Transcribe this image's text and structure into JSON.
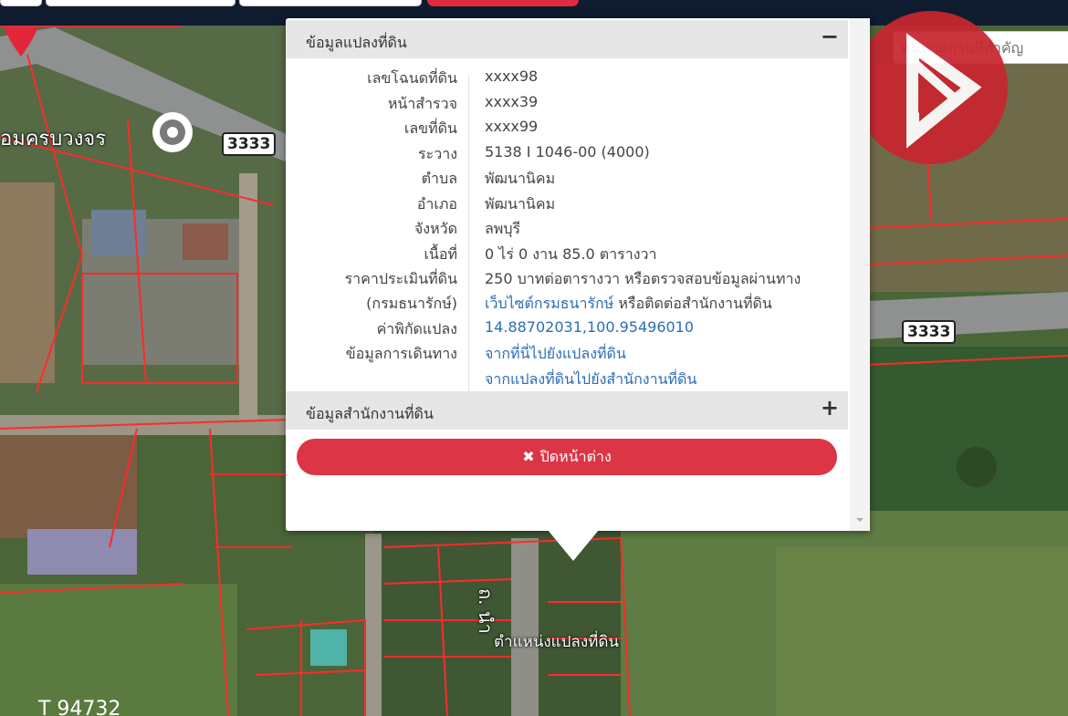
{
  "search": {
    "placeholder": "ค้นหาสถานที่สำคัญ"
  },
  "map": {
    "place_label": "อมครบวงจร",
    "road_number_1": "3333",
    "road_number_2": "3333",
    "street_label": "ถ. นำ",
    "pin_label": "ตำแหน่งแปลงที่ดิน",
    "parcel_label": "T 94732"
  },
  "popup": {
    "section1_title": "ข้อมูลแปลงที่ดิน",
    "section1_toggle": "−",
    "rows": [
      {
        "label": "เลขโฉนดที่ดิน",
        "value": "xxxx98"
      },
      {
        "label": "หน้าสำรวจ",
        "value": "xxxx39"
      },
      {
        "label": "เลขที่ดิน",
        "value": "xxxx99"
      },
      {
        "label": "ระวาง",
        "value": "5138 I 1046-00 (4000)"
      },
      {
        "label": "ตำบล",
        "value": "พัฒนานิคม"
      },
      {
        "label": "อำเภอ",
        "value": "พัฒนานิคม"
      },
      {
        "label": "จังหวัด",
        "value": "ลพบุรี"
      },
      {
        "label": "เนื้อที่",
        "value": "0 ไร่ 0 งาน 85.0 ตารางวา"
      },
      {
        "label": "ราคาประเมินที่ดิน",
        "value": "250 บาทต่อตารางวา หรือตรวจสอบข้อมูลผ่านทาง"
      }
    ],
    "treasury_label": "(กรมธนารักษ์)",
    "treasury_link": "เว็บไซต์กรมธนารักษ์",
    "treasury_suffix": " หรือติดต่อสำนักงานที่ดิน",
    "coord_label": "ค่าพิกัดแปลง",
    "coord_value": "14.88702031,100.95496010",
    "travel_label": "ข้อมูลการเดินทาง",
    "travel_link_1": "จากที่นี่ไปยังแปลงที่ดิน",
    "travel_link_2": "จากแปลงที่ดินไปยังสำนักงานที่ดิน",
    "section2_title": "ข้อมูลสำนักงานที่ดิน",
    "section2_toggle": "+",
    "close_icon": "✖",
    "close_label": "ปิดหน้าต่าง"
  },
  "colors": {
    "topbar": "#0f1b2e",
    "brand_red": "#e02a3f",
    "close_button": "#dc3545",
    "link": "#2c6db5",
    "parcel_lines": "#ff2a2a"
  },
  "icons": {
    "place_marker": "location-target-icon",
    "pin": "map-pin-icon",
    "close": "close-x-icon",
    "logo": "brand-logo-icon"
  }
}
